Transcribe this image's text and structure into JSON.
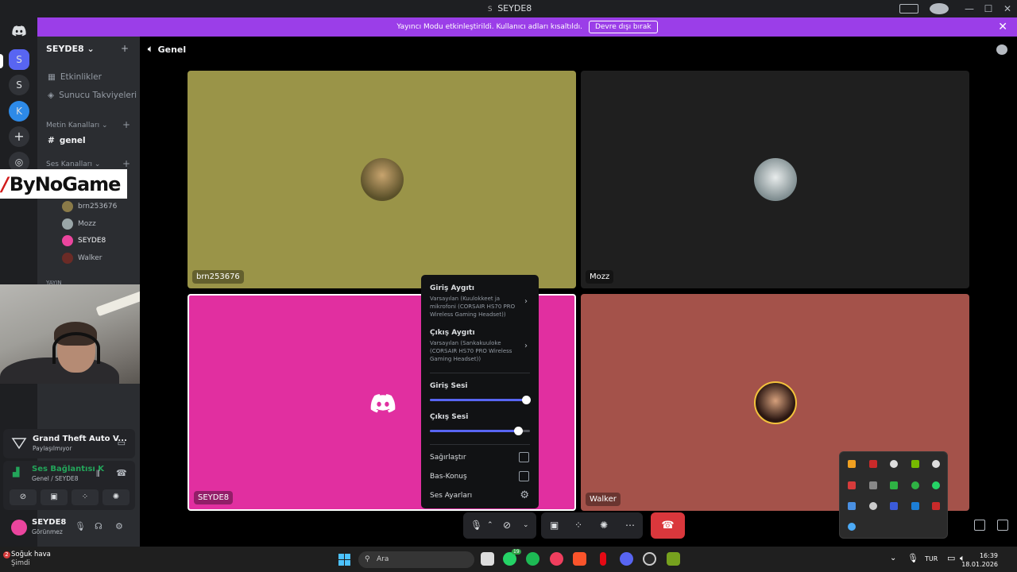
{
  "titlebar": {
    "server_letter": "S",
    "title": "SEYDE8"
  },
  "banner": {
    "message": "Yayıncı Modu etkinleştirildi. Kullanıcı adları kısaltıldı.",
    "button": "Devre dışı bırak"
  },
  "rail": {
    "servers": [
      "S",
      "S"
    ]
  },
  "sidebar": {
    "server_name": "SEYDE8",
    "events": "Etkinlikler",
    "boosts": "Sunucu Takviyeleri",
    "text_category": "Metin Kanalları",
    "text_channel": "genel",
    "voice_category": "Ses Kanalları",
    "voice_users": [
      "brn253676",
      "Mozz",
      "SEYDE8",
      "Walker"
    ],
    "truncated_category": "YAYIN"
  },
  "watermark": {
    "text": "ByNoGame"
  },
  "activity": {
    "game": "Grand Theft Auto V...",
    "status": "Paylaşılmıyor"
  },
  "voice_panel": {
    "status": "Ses Bağlantısı K",
    "channel": "Genel / SEYDE8"
  },
  "user_panel": {
    "name": "SEYDE8",
    "status": "Görünmez"
  },
  "stage": {
    "channel_title": "Genel",
    "tiles": [
      {
        "name": "brn253676",
        "color": "#9a9448"
      },
      {
        "name": "Mozz",
        "color": "#1f1f1f"
      },
      {
        "name": "SEYDE8",
        "color": "#e12fa0"
      },
      {
        "name": "Walker",
        "color": "#a4524a"
      }
    ]
  },
  "audio_menu": {
    "input_device_title": "Giriş Aygıtı",
    "input_device_value": "Varsayılan (Kuulokkeet ja mikrofoni (CORSAIR HS70 PRO Wireless Gaming Headset))",
    "output_device_title": "Çıkış Aygıtı",
    "output_device_value": "Varsayılan (Sankakuuloke (CORSAIR HS70 PRO Wireless Gaming Headset))",
    "input_volume_label": "Giriş Sesi",
    "input_volume": 0.96,
    "output_volume_label": "Çıkış Sesi",
    "output_volume": 0.88,
    "deafen_label": "Sağırlaştır",
    "deafen": false,
    "ptt_label": "Bas-Konuş",
    "ptt": false,
    "settings_label": "Ses Ayarları"
  },
  "taskbar": {
    "weather_title": "Soğuk hava",
    "weather_sub": "Şimdi",
    "weather_badge": "2",
    "search_placeholder": "Ara",
    "whatsapp_badge": "19",
    "language": "TUR",
    "time": "16:39",
    "date": "18.01.2026"
  }
}
